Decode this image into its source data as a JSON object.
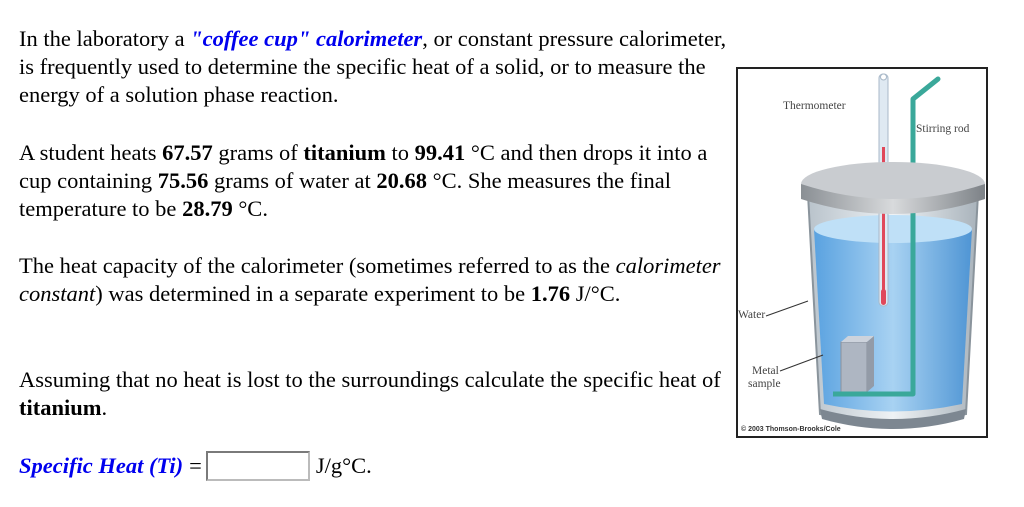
{
  "intro": {
    "t1": "In the laboratory a ",
    "highlight": "\"coffee cup\" calorimeter",
    "t2": ", or constant pressure calorimeter, is frequently used to determine the specific heat of a solid, or to measure the energy of a solution phase reaction."
  },
  "experiment": {
    "t1": "A student heats ",
    "metal_mass": "67.57",
    "t2": " grams of ",
    "metal": "titanium",
    "t3": " to ",
    "metal_temp": "99.41",
    "t4": " °C and then drops it into a cup containing ",
    "water_mass": "75.56",
    "t5": " grams of water at ",
    "water_temp": "20.68",
    "t6": " °C. She measures the final temperature to be ",
    "final_temp": "28.79",
    "t7": " °C."
  },
  "calorimeter": {
    "t1": "The heat capacity of the calorimeter (sometimes referred to as the ",
    "term": "calorimeter constant",
    "t2": ") was determined in a separate experiment to be ",
    "value": "1.76",
    "unit": " J/°C."
  },
  "question": {
    "t1": "Assuming that no heat is lost to the surroundings calculate the specific heat of ",
    "metal": "titanium",
    "t2": "."
  },
  "answer": {
    "label": "Specific Heat (Ti)",
    "equals": "=",
    "value": "",
    "unit": "J/g°C."
  },
  "figure": {
    "labels": {
      "thermometer": "Thermometer",
      "stirring_rod": "Stirring rod",
      "water": "Water",
      "metal_sample_1": "Metal",
      "metal_sample_2": "sample"
    },
    "credit": "© 2003 Thomson-Brooks/Cole"
  },
  "colors": {
    "highlight": "#0000ee",
    "water": "#7fb8e8",
    "thermometer_liquid": "#e0485a",
    "stirring_rod": "#3aa89a"
  }
}
